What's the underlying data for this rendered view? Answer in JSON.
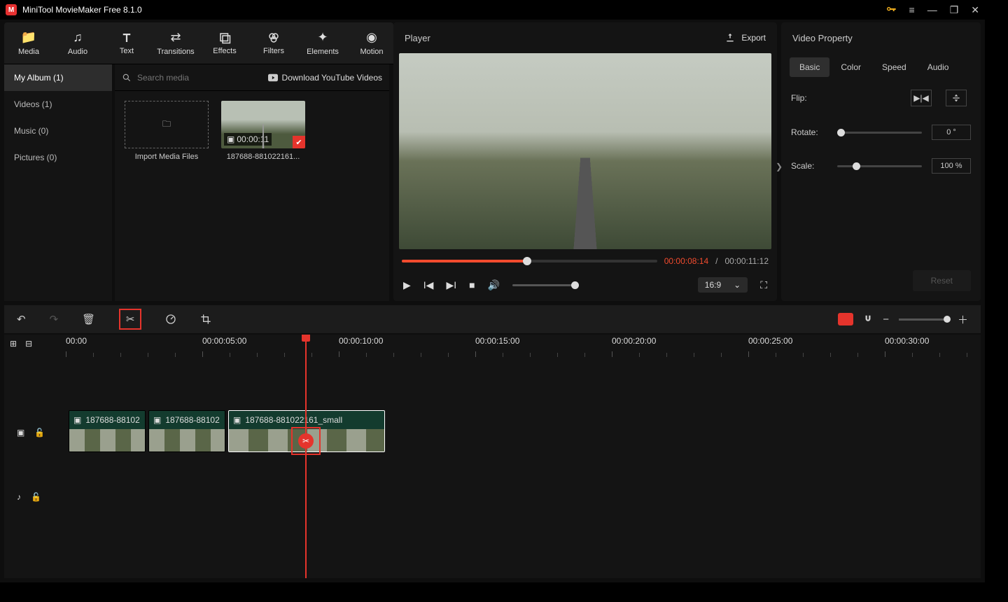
{
  "titlebar": {
    "app": "MiniTool MovieMaker Free 8.1.0"
  },
  "assetTabs": [
    {
      "label": "Media",
      "active": true
    },
    {
      "label": "Audio"
    },
    {
      "label": "Text"
    },
    {
      "label": "Transitions"
    },
    {
      "label": "Effects"
    },
    {
      "label": "Filters"
    },
    {
      "label": "Elements"
    },
    {
      "label": "Motion"
    }
  ],
  "album": {
    "items": [
      {
        "label": "My Album (1)",
        "active": true
      },
      {
        "label": "Videos (1)"
      },
      {
        "label": "Music (0)"
      },
      {
        "label": "Pictures (0)"
      }
    ],
    "search_placeholder": "Search media",
    "download_label": "Download YouTube Videos",
    "import_label": "Import Media Files",
    "clip": {
      "duration": "00:00:11",
      "name": "187688-881022161..."
    }
  },
  "player": {
    "title": "Player",
    "export": "Export",
    "cur": "00:00:08:14",
    "total": "00:00:11:12",
    "sep": " / ",
    "ratio": "16:9"
  },
  "props": {
    "title": "Video Property",
    "tabs": [
      "Basic",
      "Color",
      "Speed",
      "Audio"
    ],
    "flip_label": "Flip:",
    "rotate_label": "Rotate:",
    "rotate_val": "0 °",
    "scale_label": "Scale:",
    "scale_val": "100 %",
    "reset": "Reset"
  },
  "timeline": {
    "ticks": [
      "00:00",
      "00:00:05:00",
      "00:00:10:00",
      "00:00:15:00",
      "00:00:20:00",
      "00:00:25:00",
      "00:00:30:00"
    ],
    "clips": [
      {
        "label": "187688-88102"
      },
      {
        "label": "187688-88102"
      },
      {
        "label": "187688-881022161_small"
      }
    ]
  }
}
